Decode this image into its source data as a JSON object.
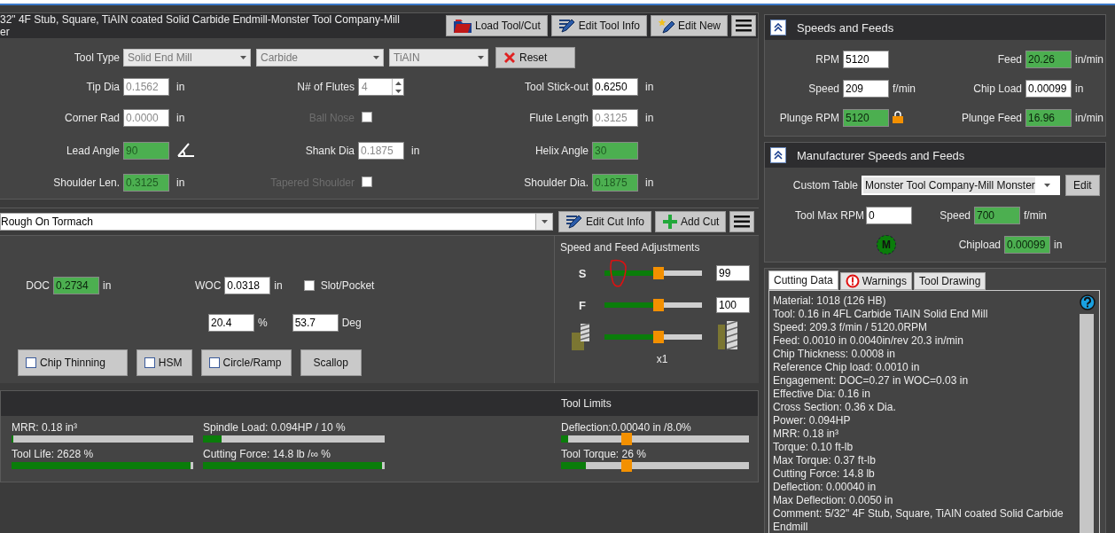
{
  "tool_header": {
    "title_lines": [
      "32\" 4F Stub, Square, TiAIN coated Solid Carbide Endmill-Monster Tool Company-Mill",
      "er"
    ],
    "buttons": [
      {
        "kind": "load",
        "label": "Load Tool/Cut"
      },
      {
        "kind": "edit",
        "label": "Edit Tool Info"
      },
      {
        "kind": "new",
        "label": "Edit New"
      },
      {
        "kind": "menu"
      }
    ]
  },
  "tool_type": {
    "label": "Tool Type",
    "selects": [
      "Solid End Mill",
      "Carbide",
      "TiAIN"
    ],
    "reset": "Reset"
  },
  "tool_rows": [
    [
      {
        "kind": "field",
        "label": "Tip Dia",
        "value": "0.1562",
        "unit": "in",
        "disabled": true,
        "highlighted": false
      },
      {
        "kind": "spinner",
        "label": "N# of Flutes",
        "value": "4",
        "disabled": true,
        "highlighted": false
      },
      {
        "kind": "field",
        "label": "Tool Stick-out",
        "value": "0.6250",
        "unit": "in",
        "disabled": false,
        "highlighted": false
      }
    ],
    [
      {
        "kind": "field",
        "label": "Corner Rad",
        "value": "0.0000",
        "unit": "in",
        "disabled": true,
        "highlighted": false
      },
      {
        "kind": "checkbox",
        "label": "Ball Nose",
        "checked": false,
        "disabled": true
      },
      {
        "kind": "field",
        "label": "Flute Length",
        "value": "0.3125",
        "unit": "in",
        "disabled": true,
        "highlighted": false
      }
    ],
    [
      {
        "kind": "angle",
        "label": "Lead Angle",
        "value": "90",
        "disabled": true,
        "highlighted": true
      },
      {
        "kind": "field",
        "label": "Shank Dia",
        "value": "0.1875",
        "unit": "in",
        "disabled": true,
        "highlighted": false
      },
      {
        "kind": "field",
        "label": "Helix Angle",
        "value": "30",
        "disabled": true,
        "highlighted": true
      }
    ],
    [
      {
        "kind": "field",
        "label": "Shoulder Len.",
        "value": "0.3125",
        "unit": "in",
        "disabled": true,
        "highlighted": true
      },
      {
        "kind": "checkbox",
        "label": "Tapered Shoulder",
        "checked": false,
        "disabled": true
      },
      {
        "kind": "field",
        "label": "Shoulder Dia.",
        "value": "0.1875",
        "unit": "in",
        "disabled": true,
        "highlighted": true
      }
    ]
  ],
  "cut_bar": {
    "value": "Rough On Tormach",
    "buttons": [
      {
        "kind": "edit",
        "label": "Edit Cut Info"
      },
      {
        "kind": "add",
        "label": "Add Cut"
      },
      {
        "kind": "menu"
      }
    ]
  },
  "cut": {
    "doc": {
      "label": "DOC",
      "value": "0.2734",
      "unit": "in",
      "highlighted": true
    },
    "woc": {
      "label": "WOC",
      "value": "0.0318",
      "unit": "in",
      "highlighted": false
    },
    "slot": {
      "label": "Slot/Pocket",
      "checked": false
    },
    "percent": {
      "value": "20.4",
      "unit": "%",
      "highlighted": false
    },
    "angle": {
      "value": "53.7",
      "unit": "Deg",
      "highlighted": false
    },
    "toggles": [
      {
        "label": "Chip Thinning",
        "checked": false,
        "kind": "check"
      },
      {
        "label": "HSM",
        "checked": false,
        "kind": "check"
      },
      {
        "label": "Circle/Ramp",
        "checked": false,
        "kind": "check"
      },
      {
        "label": "Scallop",
        "kind": "plain"
      }
    ]
  },
  "adjustments": {
    "title": "Speed and Feed Adjustments",
    "sliders": [
      {
        "kind": "letter",
        "label": "S",
        "level": 0.55,
        "value": "99"
      },
      {
        "kind": "letter",
        "label": "F",
        "level": 0.55,
        "value": "100"
      },
      {
        "kind": "engagement",
        "level": 0.55
      }
    ],
    "caption": "x1"
  },
  "results": {
    "limits_title": "Tool Limits",
    "meters": [
      {
        "label": "MRR: 0.18 in³",
        "level": 0.01
      },
      {
        "label": "Spindle Load: 0.094HP / 10 %",
        "level": 0.1
      },
      {
        "label": "Tool Life: 2628 %",
        "level": 0.985
      },
      {
        "label": "Cutting Force: 14.8 lb /∞ %",
        "level": 0.985
      }
    ],
    "limits": [
      {
        "label": "Deflection:0.00040 in /8.0%",
        "level": 0.04
      },
      {
        "label": "Tool Torque: 26 %",
        "level": 0.13
      }
    ]
  },
  "speeds": {
    "title": "Speeds and Feeds",
    "expanded": true,
    "rows": [
      [
        {
          "label": "RPM",
          "value": "5120",
          "highlighted": false
        },
        {
          "label": "Feed",
          "value": "20.26",
          "unit": "in/min",
          "highlighted": true
        }
      ],
      [
        {
          "label": "Speed",
          "value": "209",
          "unit": "f/min",
          "highlighted": false
        },
        {
          "label": "Chip Load",
          "value": "0.00099",
          "unit": "in",
          "highlighted": false
        }
      ],
      [
        {
          "label": "Plunge RPM",
          "value": "5120",
          "highlighted": true,
          "locked": true
        },
        {
          "label": "Plunge Feed",
          "value": "16.96",
          "unit": "in/min",
          "highlighted": true
        }
      ]
    ]
  },
  "manufacturer": {
    "title": "Manufacturer Speeds and Feeds",
    "expanded": true,
    "table_label": "Custom Table",
    "table_value": "Monster Tool Company-Mill Monster",
    "edit": "Edit",
    "max_rpm": {
      "label": "Tool Max RPM",
      "value": "0",
      "highlighted": false
    },
    "speed": {
      "label": "Speed",
      "value": "700",
      "unit": "f/min",
      "highlighted": true
    },
    "badge": "M",
    "chipload": {
      "label": "Chipload",
      "value": "0.00099",
      "unit": "in",
      "highlighted": true
    }
  },
  "tabs": [
    {
      "label": "Cutting Data",
      "selected": true,
      "kind": "plain"
    },
    {
      "label": "Warnings",
      "selected": false,
      "kind": "warning"
    },
    {
      "label": "Tool Drawing",
      "selected": false,
      "kind": "plain"
    }
  ],
  "cutting_data": [
    "Material: 1018 (126 HB)",
    "Tool: 0.16 in 4FL Carbide TiAIN Solid End Mill",
    "Speed: 209.3 f/min / 5120.0RPM",
    "Feed: 0.0010 in 0.0040in/rev 20.3 in/min",
    "Chip Thickness: 0.0008 in",
    "Reference Chip load: 0.0010 in",
    "Engagement: DOC=0.27 in WOC=0.03 in",
    "Effective Dia: 0.16 in",
    "Cross Section: 0.36 x Dia.",
    "Power: 0.094HP",
    "MRR: 0.18 in³",
    "Torque: 0.10 ft-lb",
    "Max Torque: 0.37 ft-lb",
    "Cutting Force: 14.8 lb",
    "Deflection: 0.00040 in",
    "Max Deflection: 0.0050 in",
    "Comment: 5/32\" 4F Stub, Square, TiAIN coated Solid Carbide Endmill"
  ]
}
